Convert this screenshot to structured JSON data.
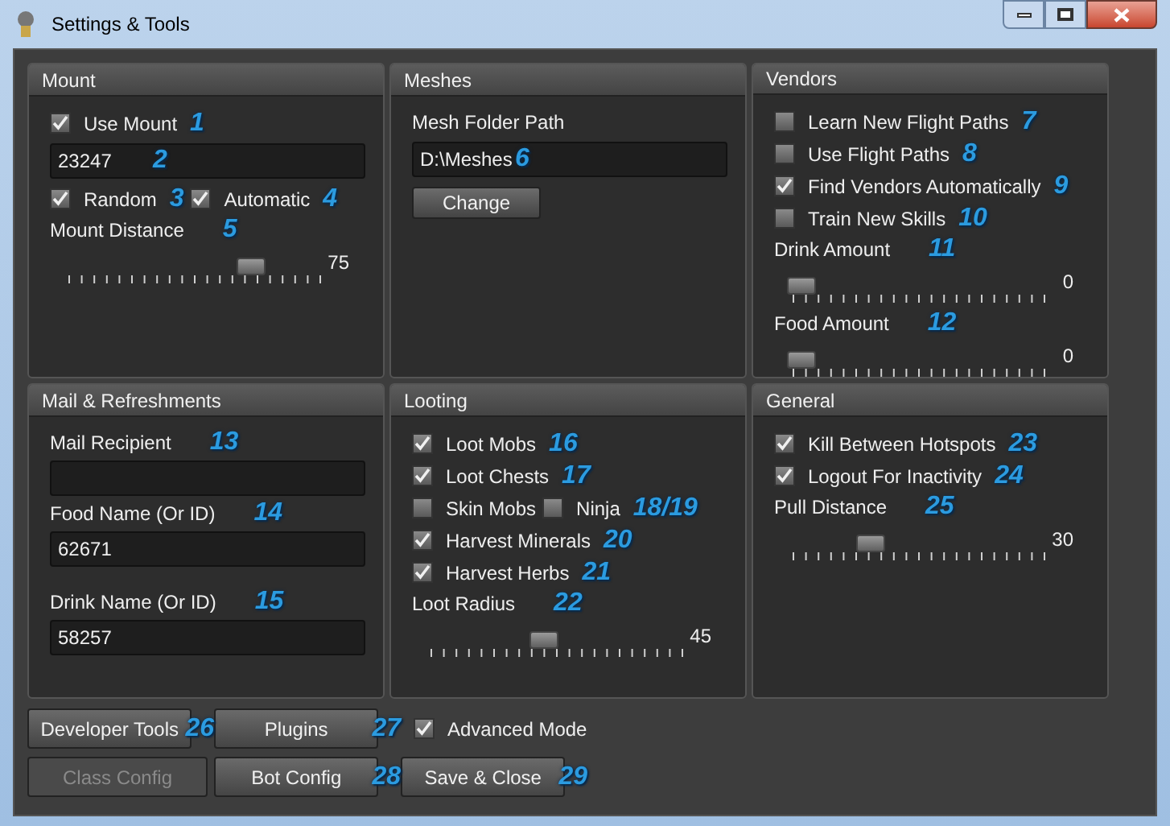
{
  "window": {
    "title": "Settings & Tools"
  },
  "panels": [
    {
      "title": "Mount",
      "items": [
        {
          "kind": "checkbox",
          "label": "Use Mount",
          "checked": true,
          "callout": "1"
        },
        {
          "kind": "input",
          "value": "23247",
          "callout": "2"
        },
        {
          "kind": "checkrow",
          "checks": [
            {
              "label": "Random",
              "checked": true,
              "callout": "3"
            },
            {
              "label": "Automatic",
              "checked": true,
              "callout": "4"
            }
          ]
        },
        {
          "kind": "label",
          "text": "Mount Distance",
          "callout": "5"
        },
        {
          "kind": "slider",
          "level": 0.75,
          "reading": "75"
        }
      ]
    },
    {
      "title": "Meshes",
      "items": [
        {
          "kind": "label",
          "text": "Mesh Folder Path"
        },
        {
          "kind": "input",
          "value": "D:\\Meshes",
          "callout": "6"
        },
        {
          "kind": "button",
          "label": "Change"
        }
      ]
    },
    {
      "title": "Vendors",
      "items": [
        {
          "kind": "checkbox",
          "label": "Learn New Flight Paths",
          "checked": false,
          "callout": "7"
        },
        {
          "kind": "checkbox",
          "label": "Use Flight Paths",
          "checked": false,
          "callout": "8"
        },
        {
          "kind": "checkbox",
          "label": "Find Vendors Automatically",
          "checked": true,
          "callout": "9"
        },
        {
          "kind": "checkbox",
          "label": "Train New Skills",
          "checked": false,
          "callout": "10"
        },
        {
          "kind": "label",
          "text": "Drink Amount",
          "callout": "11"
        },
        {
          "kind": "slider",
          "level": 0,
          "reading": "0"
        },
        {
          "kind": "label",
          "text": "Food Amount",
          "callout": "12"
        },
        {
          "kind": "slider",
          "level": 0,
          "reading": "0"
        }
      ]
    },
    {
      "title": "Mail & Refreshments",
      "items": [
        {
          "kind": "label",
          "text": "Mail Recipient",
          "callout": "13"
        },
        {
          "kind": "input"
        },
        {
          "kind": "label",
          "text": "Food Name (Or ID)",
          "callout": "14"
        },
        {
          "kind": "input",
          "value": "62671"
        },
        {
          "kind": "spacer"
        },
        {
          "kind": "label",
          "text": "Drink Name (Or ID)",
          "callout": "15"
        },
        {
          "kind": "input",
          "value": "58257"
        }
      ]
    },
    {
      "title": "Looting",
      "items": [
        {
          "kind": "checkbox",
          "label": "Loot Mobs",
          "checked": true,
          "callout": "16"
        },
        {
          "kind": "checkbox",
          "label": "Loot Chests",
          "checked": true,
          "callout": "17"
        },
        {
          "kind": "checkrow",
          "checks": [
            {
              "label": "Skin Mobs",
              "checked": false
            },
            {
              "label": "Ninja",
              "checked": false,
              "callout": "18/19"
            }
          ]
        },
        {
          "kind": "checkbox",
          "label": "Harvest Minerals",
          "checked": true,
          "callout": "20"
        },
        {
          "kind": "checkbox",
          "label": "Harvest Herbs",
          "checked": true,
          "callout": "21"
        },
        {
          "kind": "label",
          "text": "Loot Radius",
          "callout": "22"
        },
        {
          "kind": "slider",
          "level": 0.45,
          "reading": "45"
        }
      ]
    },
    {
      "title": "General",
      "items": [
        {
          "kind": "checkbox",
          "label": "Kill Between Hotspots",
          "checked": true,
          "callout": "23"
        },
        {
          "kind": "checkbox",
          "label": "Logout For Inactivity",
          "checked": true,
          "callout": "24"
        },
        {
          "kind": "label",
          "text": "Pull Distance",
          "callout": "25"
        },
        {
          "kind": "slider",
          "level": 0.3,
          "reading": "30"
        }
      ]
    }
  ],
  "footer_rows": [
    [
      {
        "kind": "button",
        "label": "Developer Tools",
        "disabled": false,
        "callout": "26"
      },
      {
        "kind": "button",
        "label": "Plugins",
        "disabled": false,
        "callout": "27"
      },
      {
        "kind": "checkbox",
        "label": "Advanced Mode",
        "checked": true
      }
    ],
    [
      {
        "kind": "button",
        "label": "Class Config",
        "disabled": true
      },
      {
        "kind": "button",
        "label": "Bot Config",
        "disabled": false,
        "callout": "28"
      },
      {
        "kind": "button",
        "label": "Save & Close",
        "disabled": false,
        "callout": "29"
      }
    ]
  ]
}
